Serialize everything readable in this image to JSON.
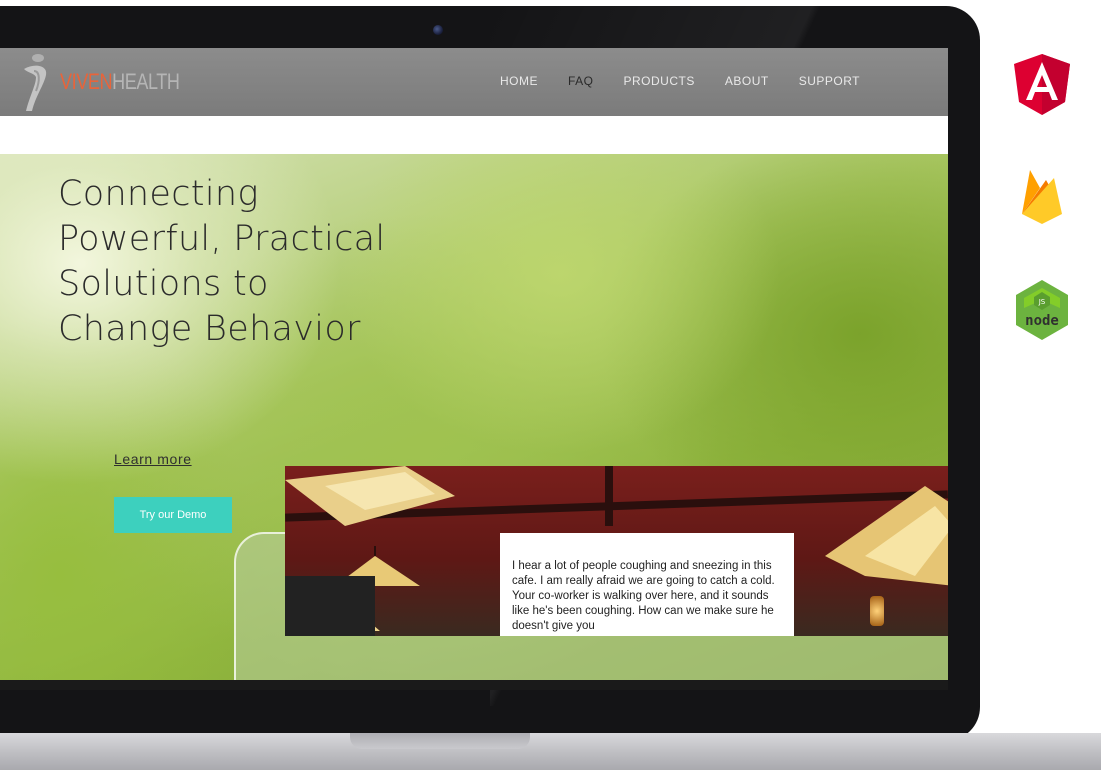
{
  "app": {
    "logo": {
      "part1": "VIVEN",
      "part2": "HEALTH"
    },
    "nav": {
      "items": [
        {
          "label": "HOME",
          "active": false
        },
        {
          "label": "FAQ",
          "active": true
        },
        {
          "label": "PRODUCTS",
          "active": false
        },
        {
          "label": "ABOUT",
          "active": false
        },
        {
          "label": "SUPPORT",
          "active": false
        }
      ]
    },
    "hero": {
      "title_lines": [
        "Connecting",
        "Powerful, Practical",
        "Solutions to",
        "Change Behavior"
      ],
      "learn_more": "Learn more",
      "demo_button": "Try our Demo",
      "speech_text": "I hear a lot of people coughing and sneezing in this cafe. I am really afraid we are going to catch a cold. Your co-worker is walking over here, and it sounds like he's been coughing. How can we make sure he doesn't give you"
    },
    "tech_icons": [
      "angular-icon",
      "firebase-icon",
      "nodejs-icon"
    ],
    "colors": {
      "accent_button": "#3dd0be",
      "logo_orange": "#e8643a",
      "nav_bar": "#8c8c8c",
      "angular_red": "#dd0031",
      "firebase_yellow": "#ffca28",
      "node_green": "#8cc84b"
    }
  }
}
